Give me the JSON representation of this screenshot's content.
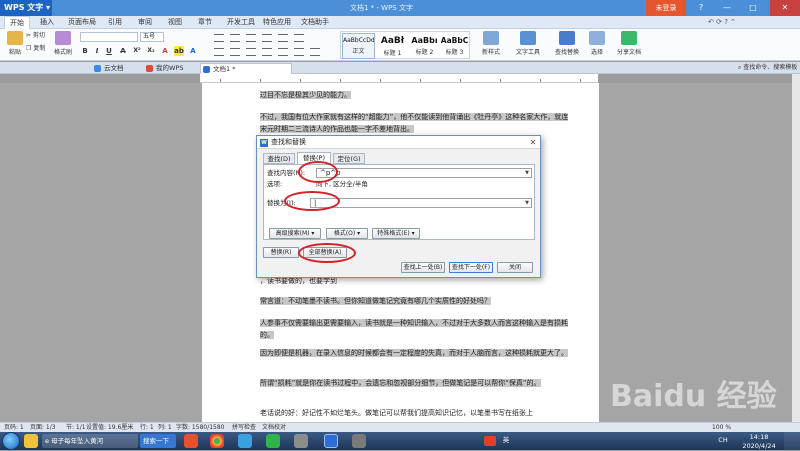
{
  "titlebar": {
    "app_name": "WPS 文字",
    "doc_title": "文档1 * - WPS 文字",
    "login": "未登录",
    "controls": [
      "?",
      "—",
      "□",
      "✕"
    ]
  },
  "menu": {
    "items": [
      "开始",
      "插入",
      "页面布局",
      "引用",
      "审阅",
      "视图",
      "章节",
      "开发工具",
      "特色应用",
      "文档助手"
    ]
  },
  "ribbon": {
    "paste": "粘贴",
    "cut": "剪切",
    "copy": "复制",
    "format_painter": "格式刷",
    "font_size": "五号",
    "styles": [
      {
        "preview": "AaBbCcDd",
        "name": "正文"
      },
      {
        "preview": "AaBł",
        "name": "标题 1"
      },
      {
        "preview": "AaBbı",
        "name": "标题 2"
      },
      {
        "preview": "AaBbC",
        "name": "标题 3"
      }
    ],
    "new_style": "新样式",
    "text_tools": "文字工具",
    "find_replace": "查找替换",
    "select": "选择",
    "share_doc": "分享文档"
  },
  "tabs": {
    "items": [
      "云文档",
      "我的WPS",
      "文档1 *"
    ],
    "find_cmd": "查找命令、搜索模板"
  },
  "document": {
    "paragraphs": [
      "过目不忘是极其少见的能力。",
      "不过，我国有位大作家就有这样的“超能力”，他不仅能读到他背诵出《牡丹亭》这种名家大作，就连宋元时期二三流诗人的作品也能一字不差地背出。",
      "，读书要做的，也要学到",
      "常言道：不动笔墨不读书。但你知道做笔记究竟有哪几个实质性的好处吗？",
      "人参事不仅需要输出更需要输入，读书就是一种知识输入，不过对于大多数人而言这种输入是有损耗的。",
      "因为即便是机器，在录入信息的时候都会有一定程度的失真，而对于人脑而言，这种损耗就更大了。",
      "所谓“损耗”就是你在读书过程中，会遗忘和忽视部分细节，但做笔记是可以帮你“保真”的。",
      "老话说的好：好记性不如烂笔头。做笔记可以帮我们提高知识记忆，以笔墨书写在纸张上"
    ]
  },
  "dialog": {
    "title": "查找和替换",
    "tabs": [
      "查找(D)",
      "替换(P)",
      "定位(G)"
    ],
    "find_label": "查找内容(N):",
    "find_value": "^p^p",
    "options_label": "选项:",
    "options_value": "向下, 区分全/半角",
    "replace_label": "替换为(I):",
    "replace_value": "|",
    "advanced": "高级搜索(M) ▾",
    "format": "格式(O) ▾",
    "special": "特殊格式(E) ▾",
    "replace_btn": "替换(R)",
    "replace_all_btn": "全部替换(A)",
    "find_prev": "查找上一处(B)",
    "find_next": "查找下一处(F)",
    "close": "关闭"
  },
  "statusbar": {
    "page": "页码: 1",
    "pages": "页面: 1/3",
    "section": "节: 1/1",
    "setting": "设置值: 19.6厘米",
    "row": "行: 1",
    "col": "列: 1",
    "words": "字数: 1580/1580",
    "spell": "拼写检查",
    "doc_check": "文档校对",
    "zoom": "100 %"
  },
  "taskbar": {
    "search_item": "母子每年坠入黄河",
    "search_btn": "搜索一下",
    "time": "14:18",
    "date": "2020/4/24",
    "ime": "英",
    "ch": "CH"
  },
  "watermark": "Baidu 经验",
  "colors": {
    "title_blue": "#4a8fd8",
    "app_blue": "#1c64c4",
    "login_red": "#e4572e",
    "annotation_red": "#d1232a"
  }
}
